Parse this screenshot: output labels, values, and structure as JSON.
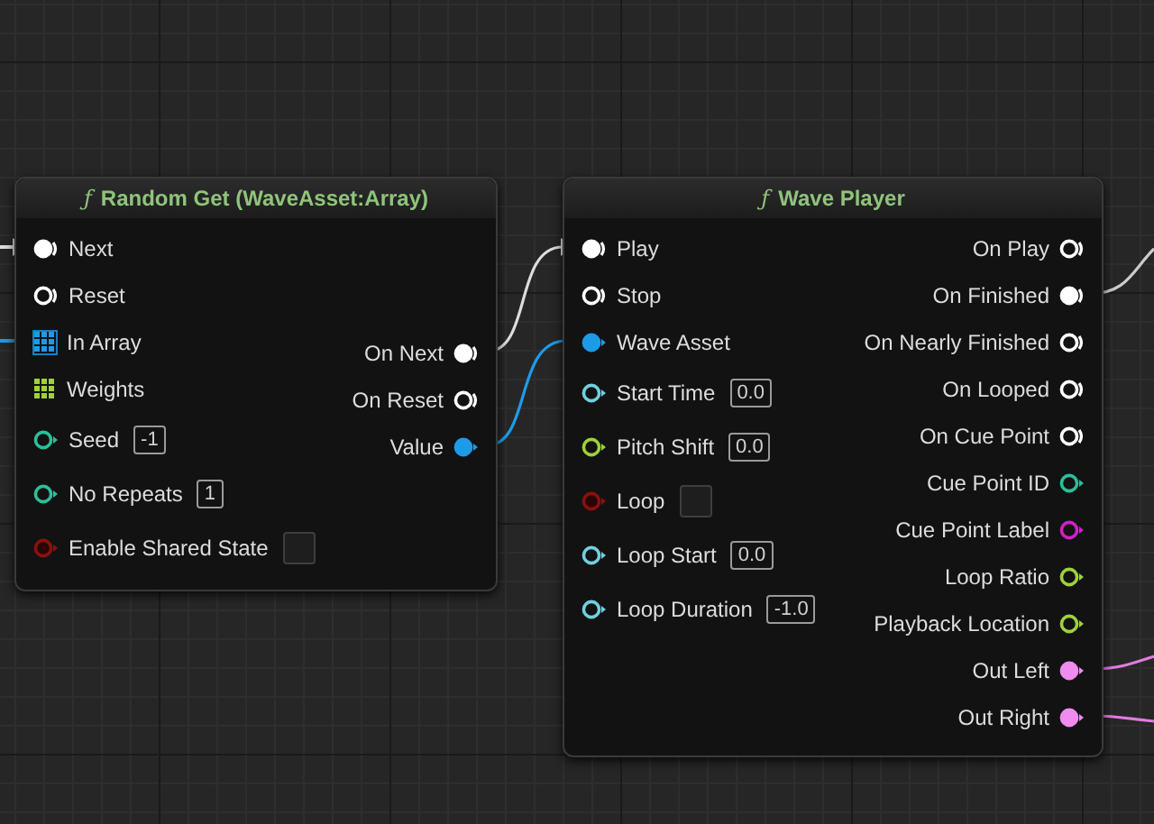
{
  "nodes": [
    {
      "icon": "ƒ",
      "title": "Random Get (WaveAsset:Array)",
      "inputs": [
        {
          "label": "Next",
          "kind": "exec",
          "color": "#ffffff",
          "connected": true
        },
        {
          "label": "Reset",
          "kind": "exec",
          "color": "#ffffff",
          "connected": false
        },
        {
          "label": "In Array",
          "kind": "array",
          "color": "#1e9be8",
          "connected": true
        },
        {
          "label": "Weights",
          "kind": "array",
          "color": "#9ed23a",
          "connected": false
        },
        {
          "label": "Seed",
          "kind": "data",
          "color": "#2bbf9a",
          "connected": false,
          "value": "-1"
        },
        {
          "label": "No Repeats",
          "kind": "data",
          "color": "#2bbf9a",
          "connected": false,
          "value": "1"
        },
        {
          "label": "Enable Shared State",
          "kind": "bool",
          "color": "#8b1010",
          "connected": false,
          "checked": false
        }
      ],
      "outputs": [
        {
          "label": "On Next",
          "kind": "exec",
          "color": "#ffffff",
          "connected": true
        },
        {
          "label": "On Reset",
          "kind": "exec",
          "color": "#ffffff",
          "connected": false
        },
        {
          "label": "Value",
          "kind": "data",
          "color": "#1e9be8",
          "connected": true
        }
      ]
    },
    {
      "icon": "ƒ",
      "title": "Wave Player",
      "inputs": [
        {
          "label": "Play",
          "kind": "exec",
          "color": "#ffffff",
          "connected": true
        },
        {
          "label": "Stop",
          "kind": "exec",
          "color": "#ffffff",
          "connected": false
        },
        {
          "label": "Wave Asset",
          "kind": "data",
          "color": "#1e9be8",
          "connected": true
        },
        {
          "label": "Start Time",
          "kind": "data",
          "color": "#6fd0e0",
          "connected": false,
          "value": "0.0"
        },
        {
          "label": "Pitch Shift",
          "kind": "data",
          "color": "#9ed23a",
          "connected": false,
          "value": "0.0"
        },
        {
          "label": "Loop",
          "kind": "bool",
          "color": "#8b1010",
          "connected": false,
          "checked": false
        },
        {
          "label": "Loop Start",
          "kind": "data",
          "color": "#6fd0e0",
          "connected": false,
          "value": "0.0"
        },
        {
          "label": "Loop Duration",
          "kind": "data",
          "color": "#6fd0e0",
          "connected": false,
          "value": "-1.0"
        }
      ],
      "outputs": [
        {
          "label": "On Play",
          "kind": "exec",
          "color": "#ffffff",
          "connected": false
        },
        {
          "label": "On Finished",
          "kind": "exec",
          "color": "#ffffff",
          "connected": true
        },
        {
          "label": "On Nearly Finished",
          "kind": "exec",
          "color": "#ffffff",
          "connected": false
        },
        {
          "label": "On Looped",
          "kind": "exec",
          "color": "#ffffff",
          "connected": false
        },
        {
          "label": "On Cue Point",
          "kind": "exec",
          "color": "#ffffff",
          "connected": false
        },
        {
          "label": "Cue Point ID",
          "kind": "data",
          "color": "#2bbf9a",
          "connected": false
        },
        {
          "label": "Cue Point Label",
          "kind": "data",
          "color": "#d21fc8",
          "connected": false
        },
        {
          "label": "Loop Ratio",
          "kind": "data",
          "color": "#9ed23a",
          "connected": false
        },
        {
          "label": "Playback Location",
          "kind": "data",
          "color": "#9ed23a",
          "connected": false
        },
        {
          "label": "Out Left",
          "kind": "data",
          "color": "#f08cf0",
          "connected": true
        },
        {
          "label": "Out Right",
          "kind": "data",
          "color": "#f08cf0",
          "connected": true
        }
      ]
    }
  ]
}
